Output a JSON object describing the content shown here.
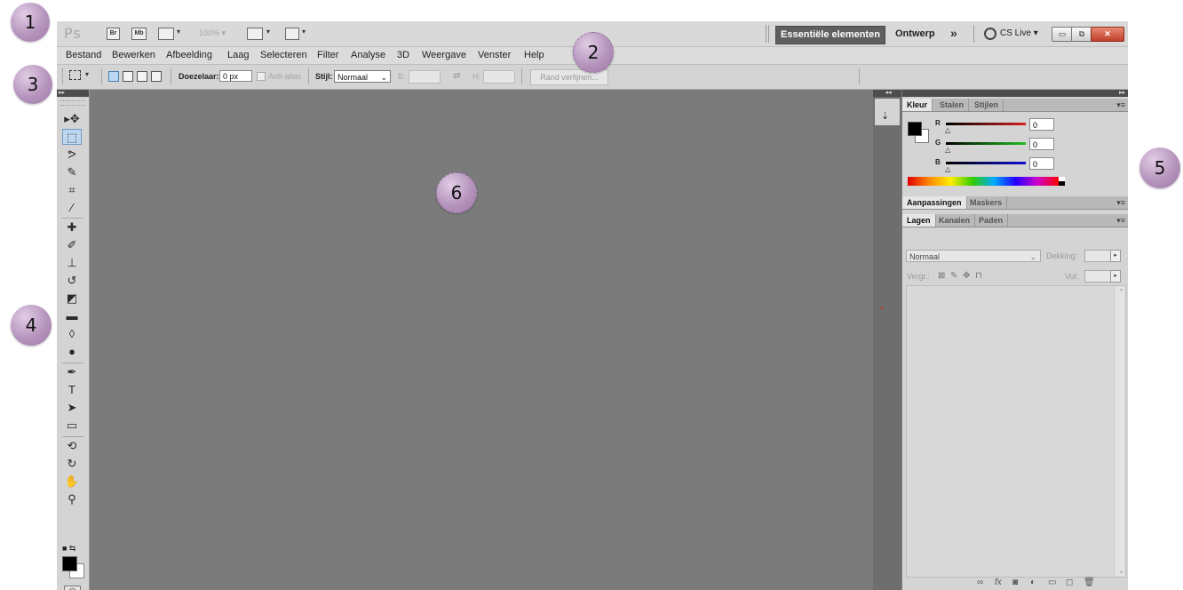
{
  "appbar": {
    "logo": "Ps",
    "bridge": "Br",
    "minibridge": "Mb",
    "zoom": "100%",
    "workspace_active": "Essentiële elementen",
    "workspace_other": "Ontwerp",
    "more": "»",
    "cslive": "CS Live"
  },
  "menu": [
    "Bestand",
    "Bewerken",
    "Afbeelding",
    "Laag",
    "Selecteren",
    "Filter",
    "Analyse",
    "3D",
    "Weergave",
    "Venster",
    "Help"
  ],
  "options": {
    "feather_label": "Doezelaar:",
    "feather_value": "0 px",
    "antialias": "Anti-alias",
    "style_label": "Stijl:",
    "style_value": "Normaal",
    "width_label": "B:",
    "height_label": "H:",
    "refine": "Rand verfijnen..."
  },
  "color_panel": {
    "tabs": [
      "Kleur",
      "Stalen",
      "Stijlen"
    ],
    "r_label": "R",
    "g_label": "G",
    "b_label": "B",
    "r": "0",
    "g": "0",
    "b": "0",
    "track_colors": {
      "r": "#d42020",
      "g": "#22c022",
      "b": "#1010d0"
    }
  },
  "adjust_panel": {
    "tabs": [
      "Aanpassingen",
      "Maskers"
    ]
  },
  "layers_panel": {
    "tabs": [
      "Lagen",
      "Kanalen",
      "Paden"
    ],
    "blend_mode": "Normaal",
    "opacity_label": "Dekking:",
    "lock_label": "Vergr.:",
    "fill_label": "Vul:"
  },
  "callouts": [
    "1",
    "2",
    "3",
    "4",
    "5",
    "6"
  ]
}
